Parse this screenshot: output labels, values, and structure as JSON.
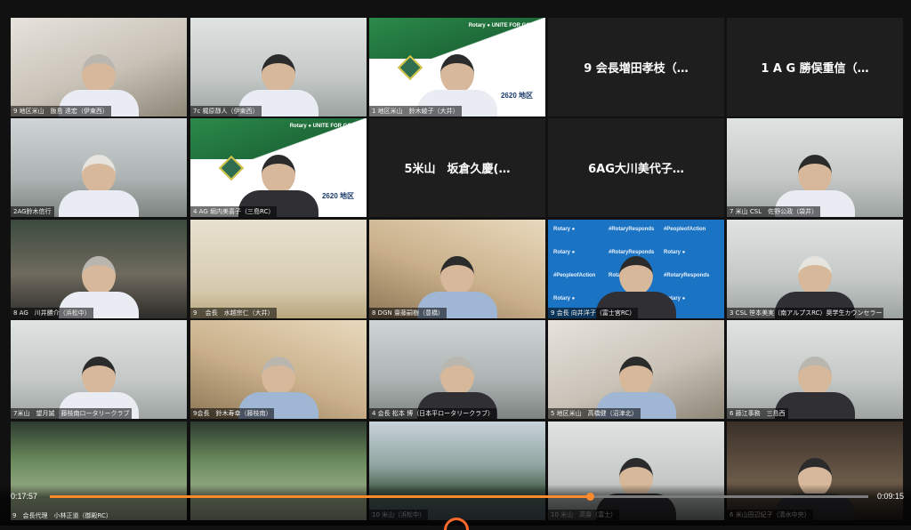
{
  "tiles": [
    {
      "label": "9 地区米山　飯島 達宏（伊東西）",
      "kind": "cam",
      "variant": "v1",
      "hair": "grey",
      "body": "light"
    },
    {
      "label": "7c 梶原靜人（伊東西）",
      "kind": "cam",
      "variant": "v4",
      "hair": "dark",
      "body": "light"
    },
    {
      "label": "1 地区米山　鈴木綾子（大井）",
      "kind": "rotary",
      "brand": "Rotary ● UNITE FOR GOOD",
      "district": "2620 地区",
      "hair": "dark",
      "body": "light"
    },
    {
      "label": "",
      "kind": "name",
      "name": "9 会長増田孝枝（…"
    },
    {
      "label": "",
      "kind": "name",
      "name": "1 A G 勝俣重信（…"
    },
    {
      "label": "2AG鈴木信行",
      "kind": "cam",
      "variant": "v2",
      "hair": "white",
      "body": "light"
    },
    {
      "label": "4 AG 堀内美喜子（三島RC）",
      "kind": "rotary",
      "brand": "Rotary ● UNITE FOR GOOD",
      "district": "2620 地区",
      "hair": "dark",
      "body": "dark"
    },
    {
      "label": "",
      "kind": "name",
      "name": "5米山　坂倉久慶(…"
    },
    {
      "label": "",
      "kind": "name",
      "name": "6AG大川美代子…"
    },
    {
      "label": "7 米山 CSL　佐野公政（袋井）",
      "kind": "cam",
      "variant": "v4",
      "hair": "dark",
      "body": "light"
    },
    {
      "label": "8 AG　川井勝介（浜松中）",
      "kind": "cam",
      "variant": "v5",
      "hair": "grey",
      "body": "light"
    },
    {
      "label": "9 　会長　水越宗仁（大井）",
      "kind": "tatami"
    },
    {
      "label": "8 DGN 齋藤嗣樹（豊橋）",
      "kind": "cam",
      "variant": "v3",
      "hair": "dark",
      "body": "blue"
    },
    {
      "label": "9 会長 向井洋子（富士宮RC）",
      "kind": "blue",
      "hair": "dark",
      "body": "dark"
    },
    {
      "label": "3 CSL 笹本美実（南アルプスRC）奨学生カウンセラー",
      "kind": "cam",
      "variant": "v4",
      "hair": "white",
      "body": "dark"
    },
    {
      "label": "7米山　望月誠　藤枝南ロータリークラブ",
      "kind": "cam",
      "variant": "v4",
      "hair": "dark",
      "body": "light"
    },
    {
      "label": "9会長　鈴木寿幸（藤枝南）",
      "kind": "cam",
      "variant": "v3",
      "hair": "grey",
      "body": "blue"
    },
    {
      "label": "4 会長 松本 博（日本平ロータリークラブ）",
      "kind": "cam",
      "variant": "v2",
      "hair": "grey",
      "body": "dark"
    },
    {
      "label": "5 地区米山　高橋健（沼津北）",
      "kind": "cam",
      "variant": "v1",
      "hair": "dark",
      "body": "blue"
    },
    {
      "label": "6 藤江事務　三島西",
      "kind": "cam",
      "variant": "v4",
      "hair": "grey",
      "body": "dark"
    },
    {
      "label": "",
      "kind": "office"
    },
    {
      "label": "",
      "kind": "office"
    },
    {
      "label": "10 米山（浜松中）",
      "kind": "scenic"
    },
    {
      "label": "10 米山　高齋（富士）",
      "kind": "cam",
      "variant": "v4",
      "hair": "dark",
      "body": "dark"
    },
    {
      "label": "6 米山田辺紀子（清水中央）",
      "kind": "head-dark",
      "hair": "dark",
      "body": "dark"
    }
  ],
  "blue_pattern": [
    "Rotary ●",
    "#RotaryResponds",
    "#PeopleofAction",
    "Rotary ●",
    "#RotaryResponds",
    "Rotary ●",
    "#PeopleofAction",
    "Rotary ●",
    "#RotaryResponds",
    "Rotary ●",
    "#PeopleofAction",
    "Rotary ●"
  ],
  "player": {
    "current_time": "0:17:57",
    "remaining_time": "0:09:15",
    "progress_fraction": 0.66
  },
  "bottom_label": "9　会長代理　小林正道（御殿RC）",
  "colors": {
    "accent": "#ff8a2b",
    "rotary_green": "#1e6b39",
    "rotary_blue": "#1b73c4"
  }
}
